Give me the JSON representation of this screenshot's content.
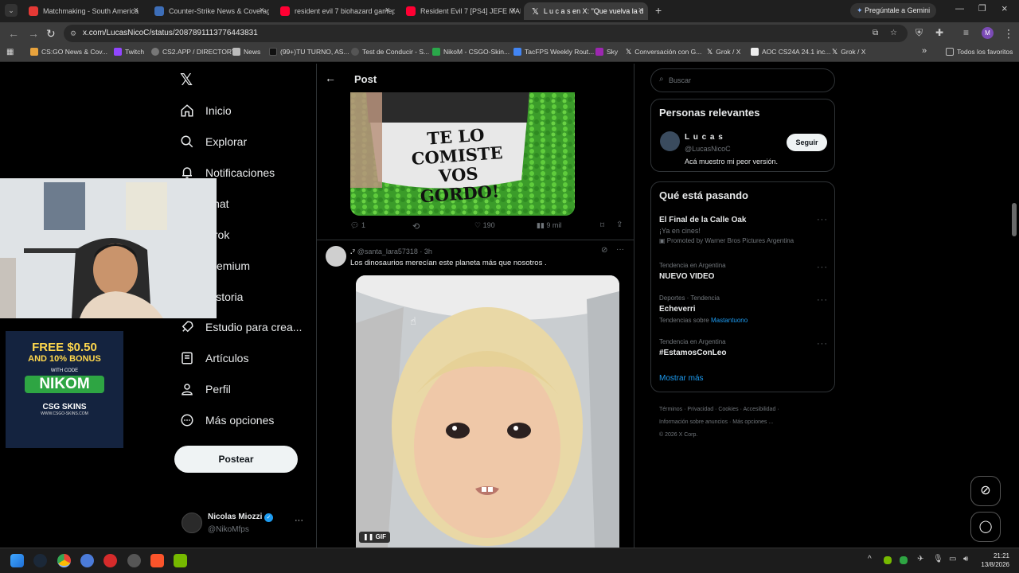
{
  "tabs": [
    {
      "title": "Matchmaking - South America",
      "color": "#e53935"
    },
    {
      "title": "Counter-Strike News & Coverag",
      "color": "#3d6eb8"
    },
    {
      "title": "resident evil 7 biohazard gamep",
      "color": "#ff0033"
    },
    {
      "title": "Resident Evil 7 [PS4] JEFE MARG",
      "color": "#ff0033"
    },
    {
      "title": "L u c a s en X: \"Que vuelva la d",
      "color": "#ffffff"
    }
  ],
  "gemini_label": "Pregúntale a Gemini",
  "url": "x.com/LucasNicoC/status/2087891113776443831",
  "bookmarks": [
    "CS:GO News & Cov...",
    "Twitch",
    "CS2.APP / DIRECTORY",
    "News",
    "(99+)TU TURNO, AS...",
    "Test de Conducir - S...",
    "NikoM - CSGO-Skin...",
    "TacFPS Weekly Rout...",
    "Sky",
    "Conversación con G...",
    "Grok / X",
    "AOC CS24A 24.1 inc...",
    "Grok / X"
  ],
  "bookmarks_more": "»",
  "all_favorites": "Todos los favoritos",
  "nav": {
    "home": "Inicio",
    "explore": "Explorar",
    "notifications": "Notificaciones",
    "chat": "Chat",
    "grok": "Grok",
    "premium": "Premium",
    "history": "Historia",
    "creator_studio": "Estudio para crea...",
    "articles": "Artículos",
    "profile": "Perfil",
    "more": "Más opciones",
    "post_button": "Postear"
  },
  "account": {
    "name": "Nicolas Miozzi",
    "handle": "@NikoMfps"
  },
  "header_title": "Post",
  "image_text": "TE LO COMISTE VOS GORDO!",
  "post_actions": {
    "replies": "1",
    "retweets": "",
    "likes": "190",
    "views": "9 mil"
  },
  "reply": {
    "name": ".⁷",
    "handle": "@santa_lara57318 · 3h",
    "text": "Los dinosaurios merecían este planeta más que nosotros .",
    "gif_label": "GIF"
  },
  "search_placeholder": "Buscar",
  "relevant": {
    "title": "Personas relevantes",
    "name": "L u c a s",
    "handle": "@LucasNicoC",
    "bio": "Acá muestro mi peor versión.",
    "follow": "Seguir"
  },
  "trends": {
    "title": "Qué está pasando",
    "items": [
      {
        "top": "El Final de la Calle Oak",
        "mid": "¡Ya en cines!",
        "bottom": "Promoted by Warner Bros Pictures Argentina"
      },
      {
        "top": "Tendencia en Argentina",
        "mid": "NUEVO VIDEO"
      },
      {
        "top": "Deportes · Tendencia",
        "mid": "Echeverri",
        "bottom": "Tendencias sobre",
        "link": "Mastantuono"
      },
      {
        "top": "Tendencia en Argentina",
        "mid": "#EstamosConLeo"
      }
    ],
    "show_more": "Mostrar más"
  },
  "footer": {
    "l1": [
      "Términos",
      "Privacidad",
      "Cookies",
      "Accesibilidad"
    ],
    "l2": [
      "Información sobre anuncios",
      "Más opciones ..."
    ],
    "copyright": "© 2026 X Corp."
  },
  "promo": {
    "line1": "FREE $0.50",
    "line2": "AND 10% BONUS",
    "line3": "WITH CODE",
    "code": "NIKOM",
    "brand": "CSG SKINS",
    "site": "WWW.CSGO-SKINS.COM"
  },
  "clock": {
    "time": "21:21",
    "date": "13/8/2026"
  }
}
